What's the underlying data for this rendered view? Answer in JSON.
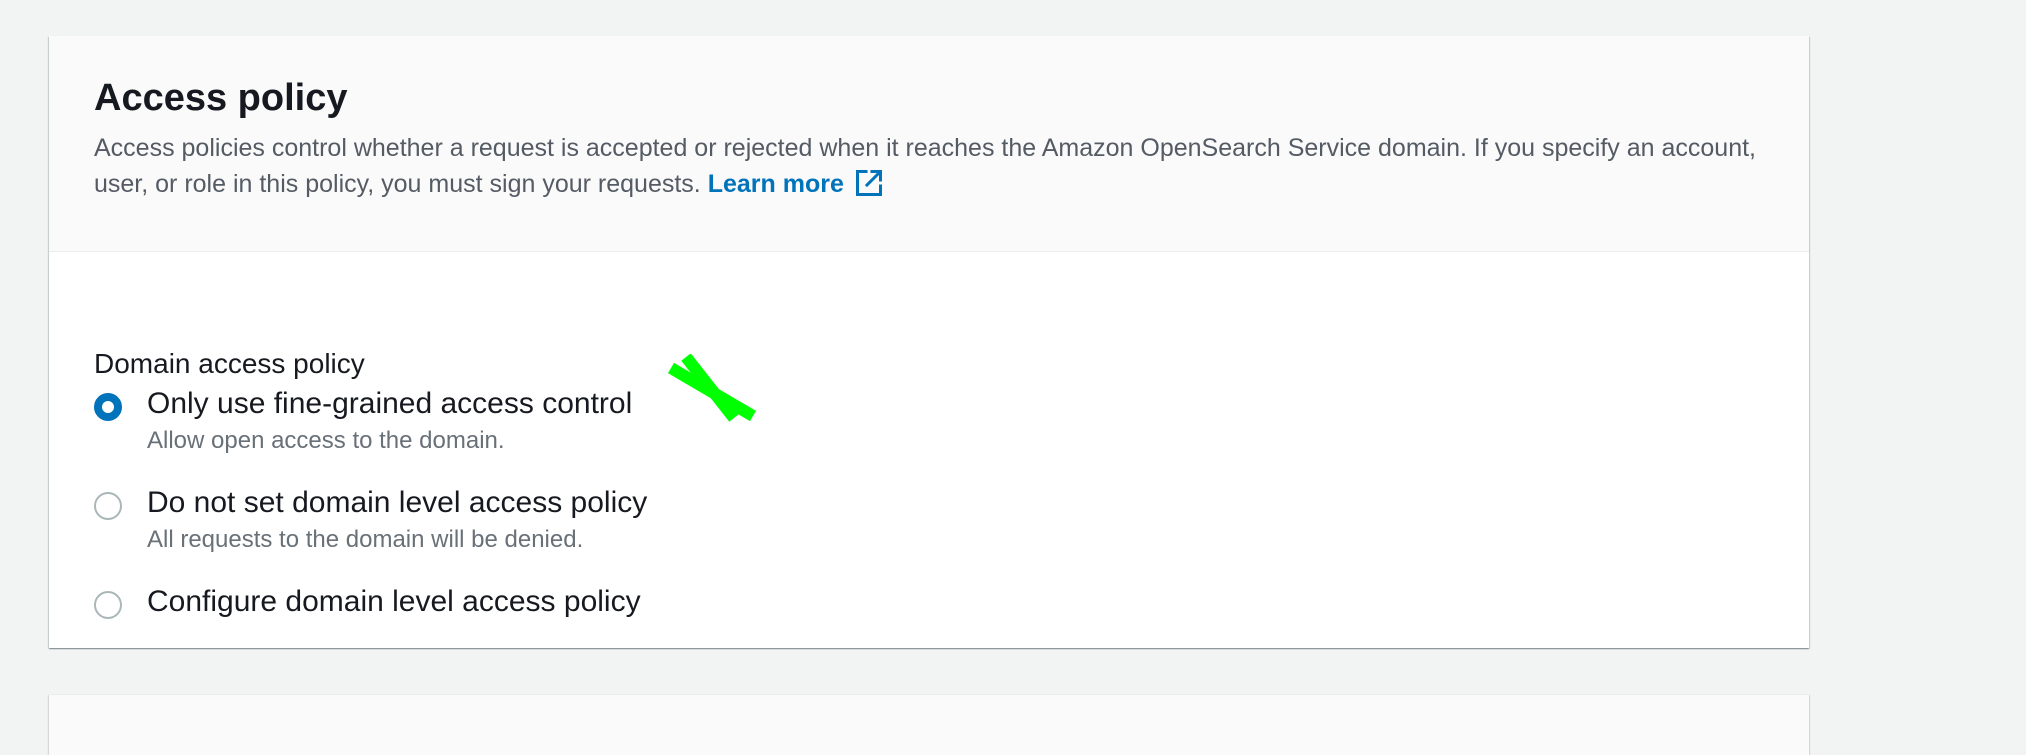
{
  "access_policy": {
    "title": "Access policy",
    "description": "Access policies control whether a request is accepted or rejected when it reaches the Amazon OpenSearch Service domain. If you specify an account, user, or role in this policy, you must sign your requests.",
    "learn_more": "Learn more",
    "learn_more_icon": "external-link-icon"
  },
  "domain_access_policy": {
    "label": "Domain access policy",
    "selected": "Only use fine-grained access control",
    "options": [
      {
        "label": "Only use fine-grained access control",
        "description": "Allow open access to the domain.",
        "checked": true
      },
      {
        "label": "Do not set domain level access policy",
        "description": "All requests to the domain will be denied.",
        "checked": false
      },
      {
        "label": "Configure domain level access policy",
        "checked": false
      }
    ]
  },
  "colors": {
    "page_background": "#f2f3f3",
    "panel_header": "#fafafa",
    "link": "#0073bb",
    "radio_selected": "#0073bb",
    "radio_border": "#aab7b8",
    "text_primary": "#16191f",
    "text_secondary": "#687078",
    "cursor_mark": "#00ff00"
  }
}
